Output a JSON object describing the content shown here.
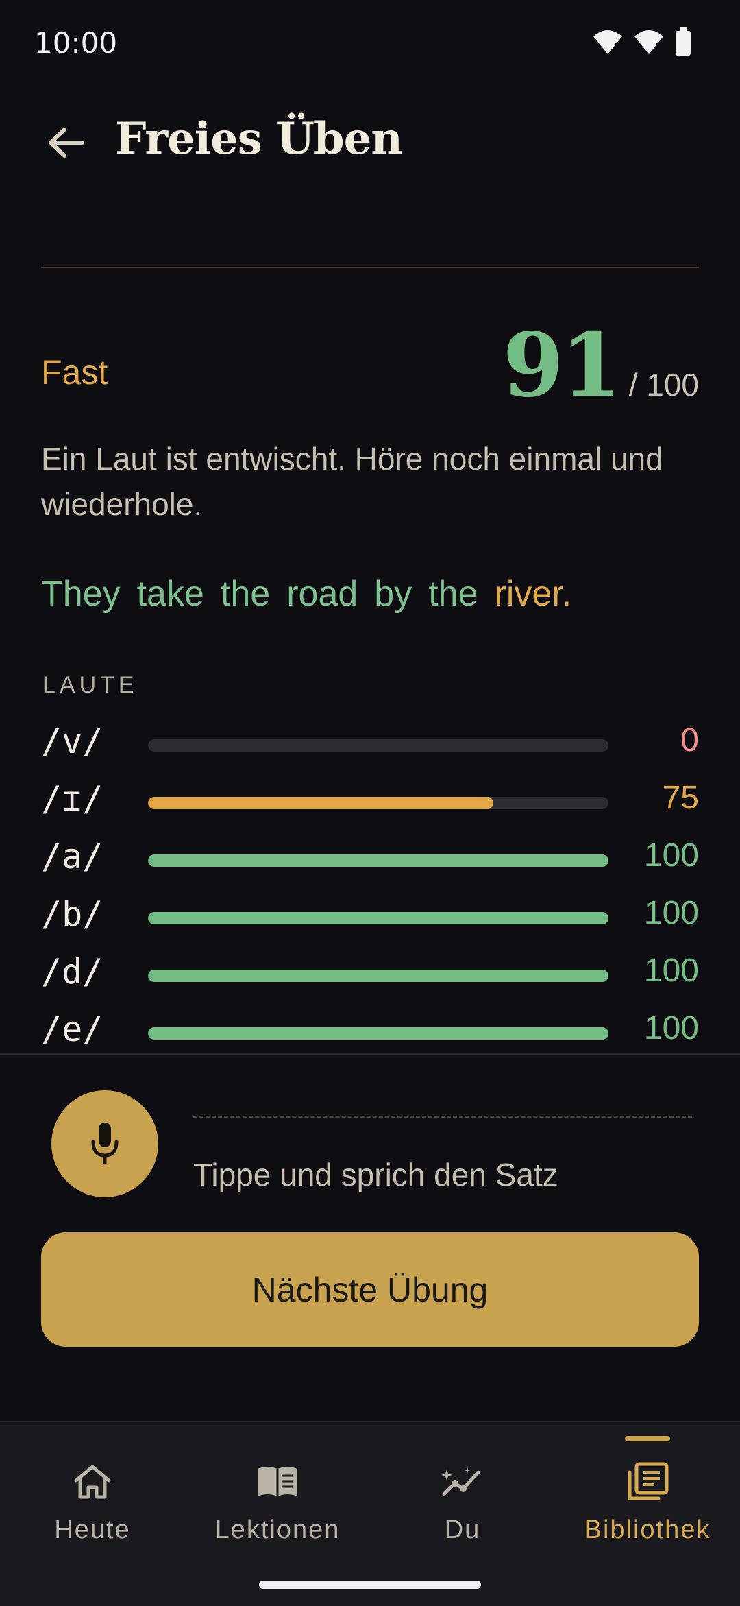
{
  "status_bar": {
    "time": "10:00"
  },
  "header": {
    "title": "Freies Üben"
  },
  "score": {
    "verdict": "Fast",
    "value": "91",
    "max": "/ 100"
  },
  "feedback": "Ein Laut ist entwischt. Höre noch einmal und wiederhole.",
  "sentence": {
    "words": [
      {
        "text": "They",
        "status": "ok"
      },
      {
        "text": "take",
        "status": "ok"
      },
      {
        "text": "the",
        "status": "ok"
      },
      {
        "text": "road",
        "status": "ok"
      },
      {
        "text": "by",
        "status": "ok"
      },
      {
        "text": "the",
        "status": "ok"
      },
      {
        "text": "river.",
        "status": "warn"
      }
    ]
  },
  "phonemes": {
    "label": "LAUTE",
    "items": [
      {
        "symbol": "/v/",
        "score": "0",
        "fraction": 0.0,
        "color": "#f08c8c"
      },
      {
        "symbol": "/ɪ/",
        "score": "75",
        "fraction": 0.75,
        "color": "#e0a848"
      },
      {
        "symbol": "/a/",
        "score": "100",
        "fraction": 1.0,
        "color": "#74bd84"
      },
      {
        "symbol": "/b/",
        "score": "100",
        "fraction": 1.0,
        "color": "#74bd84"
      },
      {
        "symbol": "/d/",
        "score": "100",
        "fraction": 1.0,
        "color": "#74bd84"
      },
      {
        "symbol": "/e/",
        "score": "100",
        "fraction": 1.0,
        "color": "#74bd84"
      }
    ]
  },
  "mic": {
    "hint": "Tippe und sprich den Satz",
    "icon": "microphone-icon"
  },
  "next_button": {
    "label": "Nächste Übung"
  },
  "nav": {
    "items": [
      {
        "label": "Heute",
        "icon": "home-icon",
        "active": false
      },
      {
        "label": "Lektionen",
        "icon": "book-icon",
        "active": false
      },
      {
        "label": "Du",
        "icon": "progress-icon",
        "active": false
      },
      {
        "label": "Bibliothek",
        "icon": "library-icon",
        "active": true
      }
    ]
  },
  "colors": {
    "accent": "#c9a24f",
    "ok": "#74bd84",
    "warn": "#e0a848",
    "bad": "#f08c8c",
    "background": "#0e0e12"
  }
}
